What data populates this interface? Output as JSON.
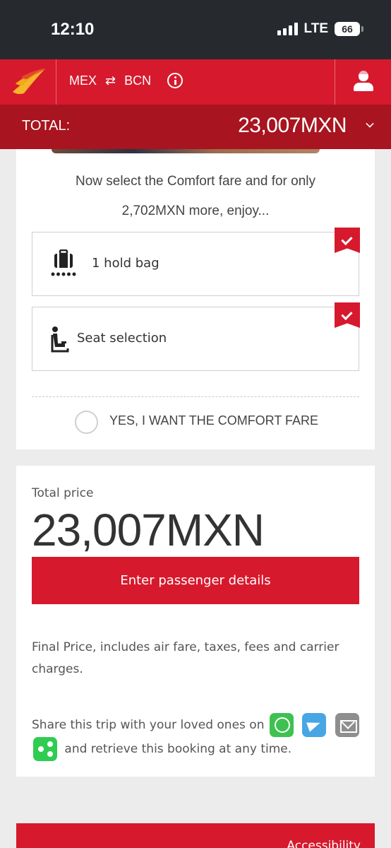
{
  "status_bar": {
    "time": "12:10",
    "network": "LTE",
    "battery": "66"
  },
  "header": {
    "origin": "MEX",
    "swap_symbol": "⇄",
    "destination": "BCN",
    "logo_icon": "iberia-logo",
    "user_icon": "user-icon",
    "info_icon": "info-icon"
  },
  "total_bar": {
    "label": "TOTAL:",
    "value": "23,007MXN",
    "chevron_icon": "chevron-down-icon"
  },
  "upsell": {
    "line1": "Now select the Comfort fare and for only",
    "line2": "2,702MXN more, enjoy...",
    "benefits": [
      {
        "label": "1 hold bag",
        "icon": "baggage-icon",
        "checked": true
      },
      {
        "label": "Seat selection",
        "icon": "seat-icon",
        "checked": true
      }
    ],
    "option_label": "YES, I WANT THE COMFORT FARE"
  },
  "price": {
    "label": "Total price",
    "value": "23,007MXN",
    "cta_label": "Enter passenger details",
    "final_note": "Final Price, includes air fare, taxes, fees and carrier charges.",
    "share_prefix": "Share this trip with your loved ones on",
    "share_suffix": "and retrieve this booking at any time."
  },
  "footer": {
    "accessibility_label": "Accessibility"
  },
  "colors": {
    "brand_red": "#d7192d",
    "dark_red": "#a8141f",
    "status_bar": "#262a2f"
  }
}
